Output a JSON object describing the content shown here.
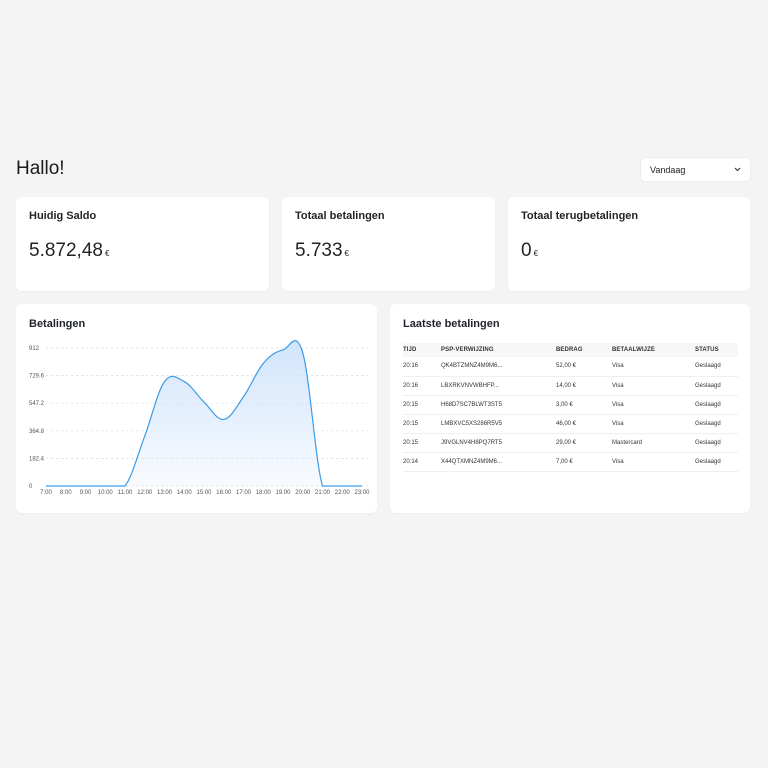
{
  "header": {
    "greeting": "Hallo!",
    "period_select": "Vandaag"
  },
  "stats": [
    {
      "title": "Huidig Saldo",
      "value": "5.872,48",
      "currency": "€"
    },
    {
      "title": "Totaal betalingen",
      "value": "5.733",
      "currency": "€"
    },
    {
      "title": "Totaal terugbetalingen",
      "value": "0",
      "currency": "€"
    }
  ],
  "payments_chart": {
    "title": "Betalingen"
  },
  "chart_data": {
    "type": "area",
    "title": "Betalingen",
    "x": [
      "7:00",
      "8:00",
      "9:00",
      "10:00",
      "11:00",
      "12:00",
      "13:00",
      "14:00",
      "15:00",
      "16:00",
      "17:00",
      "18:00",
      "19:00",
      "20:00",
      "21:00",
      "22:00",
      "23:00"
    ],
    "values": [
      0,
      0,
      0,
      0,
      0,
      330,
      690,
      690,
      555,
      440,
      590,
      810,
      900,
      880,
      0,
      0,
      0
    ],
    "y_ticks": [
      "912",
      "729.6",
      "547.2",
      "364.8",
      "182.4",
      "0"
    ],
    "ylim": [
      0,
      912
    ],
    "grid": true,
    "line_color": "#3b9be6",
    "fill_color": "#cfe3fb"
  },
  "transactions": {
    "title": "Laatste betalingen",
    "columns": [
      "TIJD",
      "PSP-VERWIJZING",
      "BEDRAG",
      "BETAALWIJZE",
      "STATUS"
    ],
    "rows": [
      [
        "20:16",
        "QK4BTZMNZ4M9M6...",
        "52,00 €",
        "Visa",
        "Geslaagd"
      ],
      [
        "20:16",
        "LBXRKVNVWBHFP...",
        "14,00 €",
        "Visa",
        "Geslaagd"
      ],
      [
        "20:15",
        "H68D7SC7BLWT3ST5",
        "3,00 €",
        "Visa",
        "Geslaagd"
      ],
      [
        "20:15",
        "LMBXVC5XS286R5V5",
        "46,00 €",
        "Visa",
        "Geslaagd"
      ],
      [
        "20:15",
        "J9VGLNV4H8PQ7RT5",
        "29,00 €",
        "Mastercard",
        "Geslaagd"
      ],
      [
        "20:14",
        "X44QTXMNZ4M9M6...",
        "7,00 €",
        "Visa",
        "Geslaagd"
      ]
    ]
  }
}
